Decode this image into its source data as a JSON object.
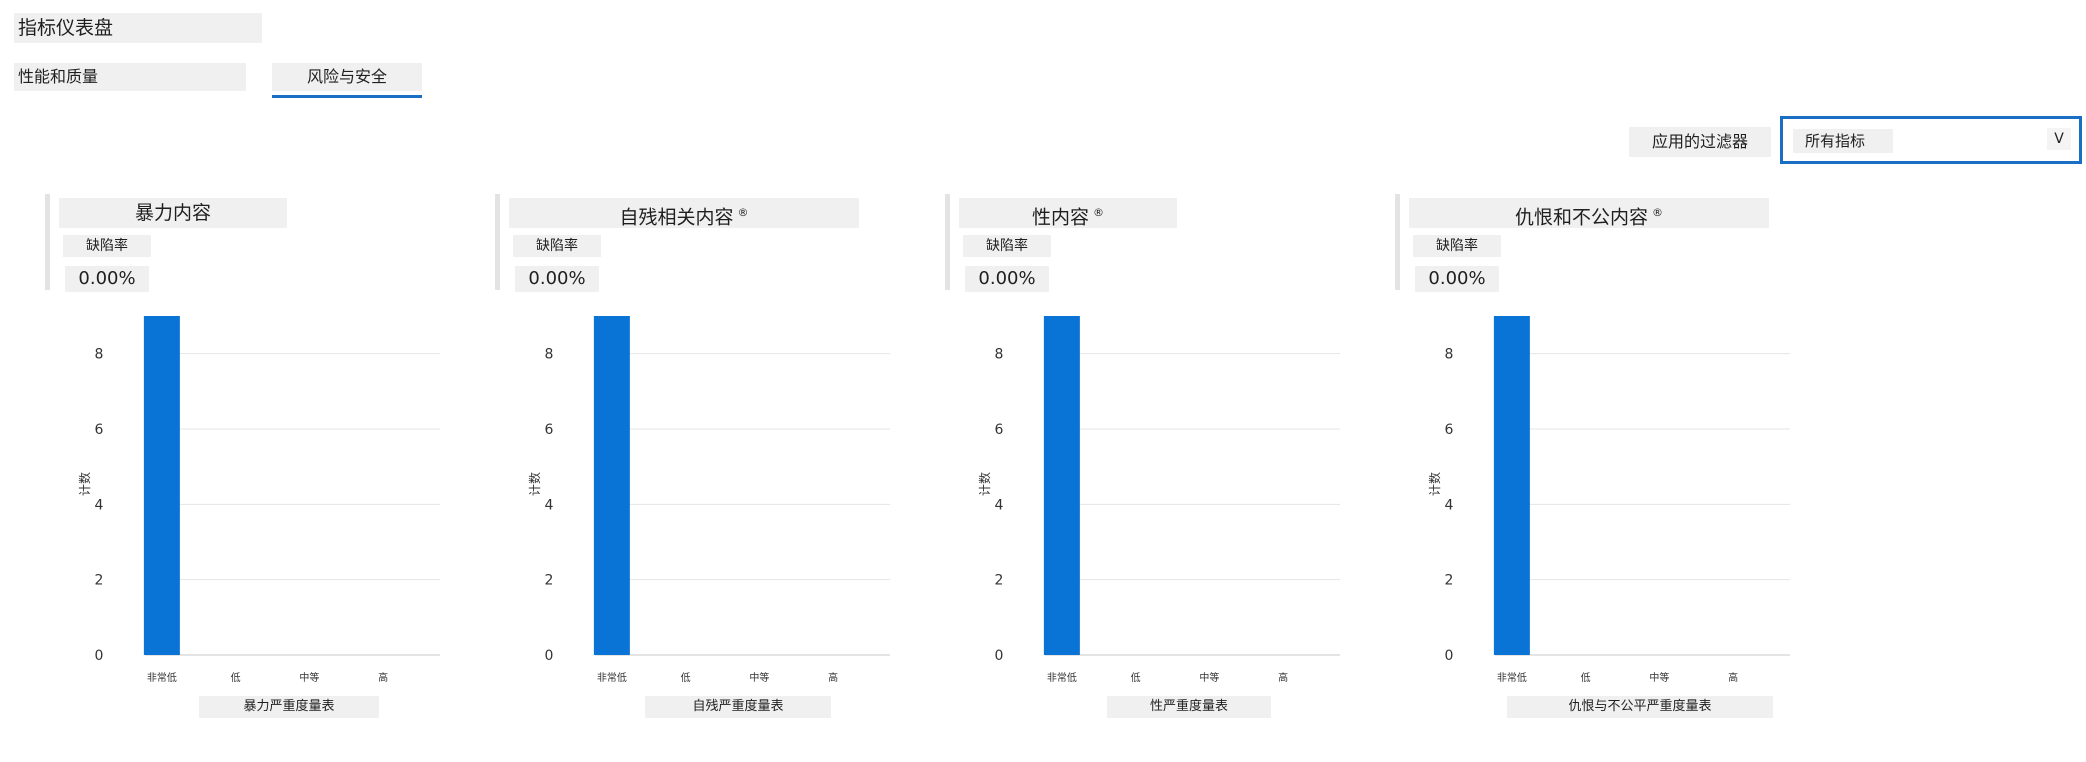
{
  "header": {
    "title": "指标仪表盘"
  },
  "tabs": [
    {
      "label": "性能和质量",
      "selected": false
    },
    {
      "label": "风险与安全",
      "selected": true
    }
  ],
  "filter": {
    "label": "应用的过滤器",
    "value": "所有指标",
    "chevron": "V"
  },
  "colors": {
    "accent": "#1a6fc4",
    "bar": "#0a74d6"
  },
  "cards": [
    {
      "title": "暴力内容",
      "has_info": false,
      "metric_label": "缺陷率",
      "metric_value": "0.00%",
      "ylabel": "计数",
      "xlabel": "暴力严重度量表"
    },
    {
      "title": "自残相关内容",
      "has_info": true,
      "metric_label": "缺陷率",
      "metric_value": "0.00%",
      "ylabel": "计数",
      "xlabel": "自残严重度量表"
    },
    {
      "title": "性内容",
      "has_info": true,
      "metric_label": "缺陷率",
      "metric_value": "0.00%",
      "ylabel": "计数",
      "xlabel": "性严重度量表"
    },
    {
      "title": "仇恨和不公内容",
      "has_info": true,
      "metric_label": "缺陷率",
      "metric_value": "0.00%",
      "ylabel": "计数",
      "xlabel": "仇恨与不公平严重度量表"
    }
  ],
  "info_symbol": "®",
  "chart_data": [
    {
      "type": "bar",
      "categories": [
        "非常低",
        "低",
        "中等",
        "高"
      ],
      "values": [
        9,
        0,
        0,
        0
      ],
      "yticks": [
        0,
        2,
        4,
        6,
        8
      ],
      "ytick_labels": [
        "0",
        "2",
        "4",
        "6",
        "8"
      ],
      "ylim": [
        0,
        9
      ],
      "xlabel": "暴力严重度量表",
      "ylabel": "计数"
    },
    {
      "type": "bar",
      "categories": [
        "非常低",
        "低",
        "中等",
        "高"
      ],
      "values": [
        9,
        0,
        0,
        0
      ],
      "yticks": [
        0,
        2,
        4,
        6,
        8
      ],
      "ytick_labels": [
        "0",
        "2",
        "4",
        "6",
        "8"
      ],
      "ylim": [
        0,
        9
      ],
      "xlabel": "自残严重度量表",
      "ylabel": "计数"
    },
    {
      "type": "bar",
      "categories": [
        "非常低",
        "低",
        "中等",
        "高"
      ],
      "values": [
        9,
        0,
        0,
        0
      ],
      "yticks": [
        0,
        2,
        4,
        6,
        8
      ],
      "ytick_labels": [
        "0",
        "2",
        "4",
        "6",
        "8"
      ],
      "ylim": [
        0,
        9
      ],
      "xlabel": "性严重度量表",
      "ylabel": "计数"
    },
    {
      "type": "bar",
      "categories": [
        "非常低",
        "低",
        "中等",
        "高"
      ],
      "values": [
        9,
        0,
        0,
        0
      ],
      "yticks": [
        0,
        2,
        4,
        6,
        8
      ],
      "ytick_labels": [
        "0",
        "2",
        "4",
        "6",
        "8"
      ],
      "ylim": [
        0,
        9
      ],
      "xlabel": "仇恨与不公平严重度量表",
      "ylabel": "计数"
    }
  ]
}
